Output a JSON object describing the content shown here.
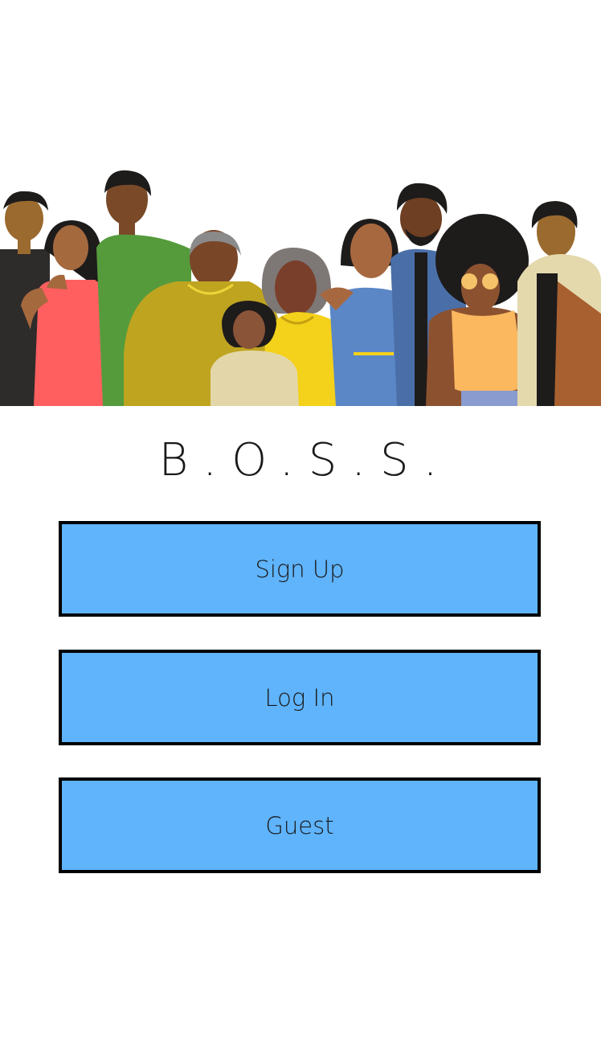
{
  "app": {
    "title": "B.O.S.S."
  },
  "illustration": {
    "icon": "group-of-people-illustration"
  },
  "buttons": {
    "sign_up": "Sign Up",
    "log_in": "Log In",
    "guest": "Guest"
  },
  "colors": {
    "button_fill": "#5fb4fc",
    "button_border": "#000000",
    "background": "#ffffff"
  }
}
